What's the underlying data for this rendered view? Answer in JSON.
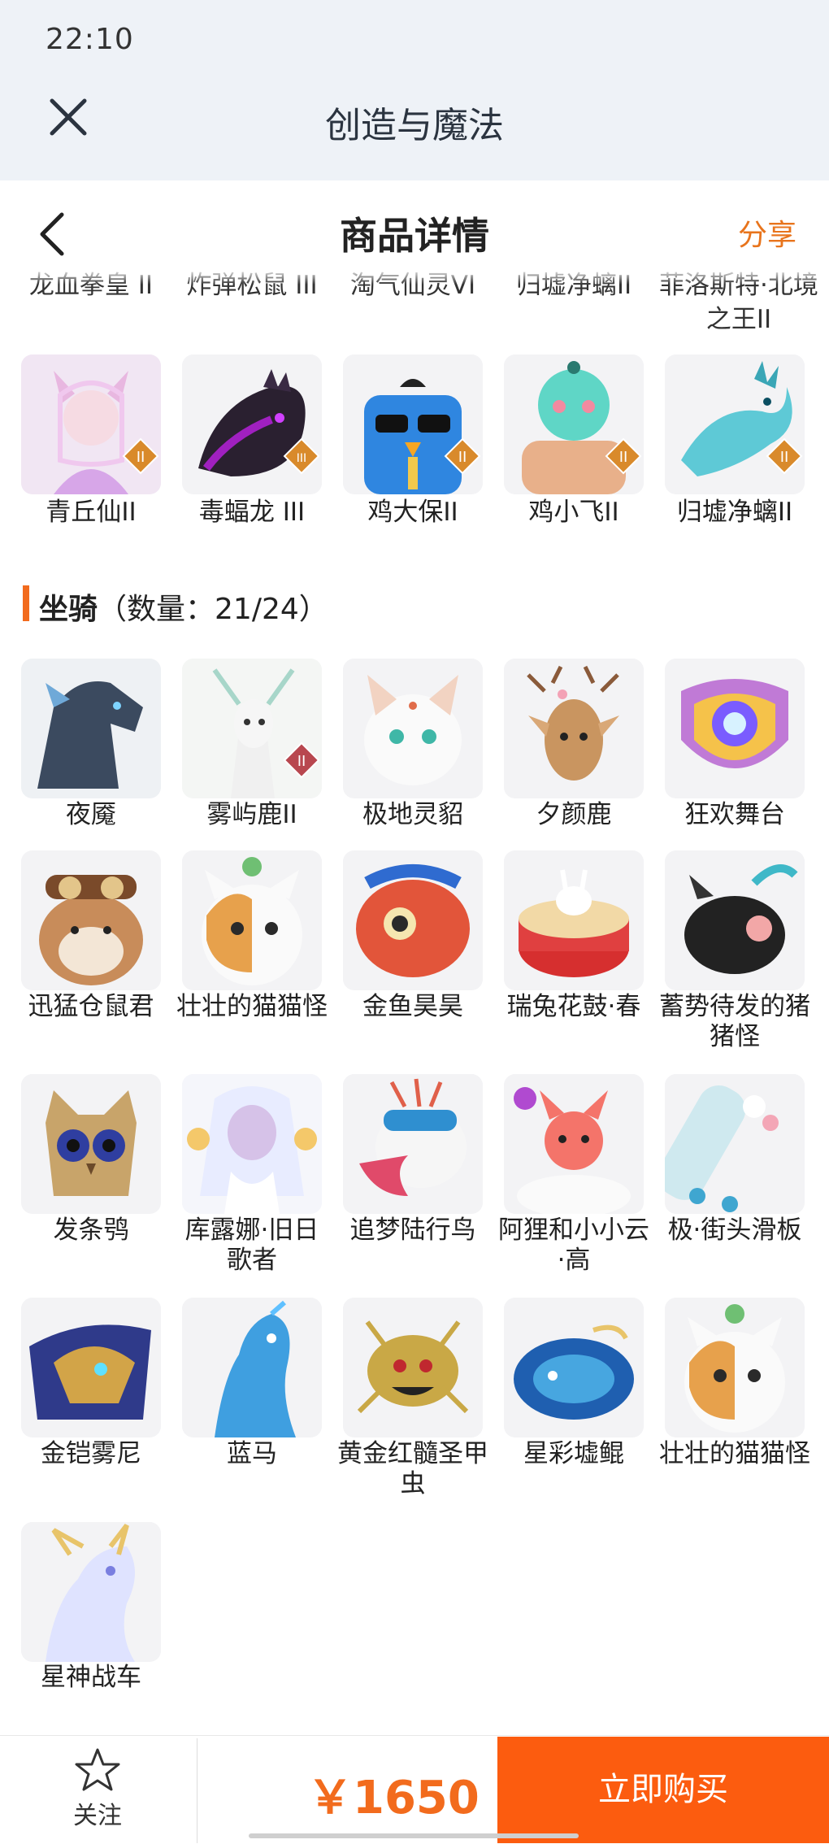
{
  "status": {
    "time": "22:10"
  },
  "app": {
    "title": "创造与魔法"
  },
  "nav": {
    "title": "商品详情",
    "share": "分享"
  },
  "partial_row": [
    "龙血拳皇 II",
    "炸弹松鼠 III",
    "淘气仙灵VI",
    "归墟净螭II",
    "菲洛斯特·北境之王II"
  ],
  "pets_row": [
    {
      "label": "青丘仙II",
      "badge": "II"
    },
    {
      "label": "毒蝠龙 III",
      "badge": "III"
    },
    {
      "label": "鸡大保II",
      "badge": "II"
    },
    {
      "label": "鸡小飞II",
      "badge": "II"
    },
    {
      "label": "归墟净螭II",
      "badge": "II"
    }
  ],
  "mounts_section": {
    "title": "坐骑",
    "count": "（数量：21/24）"
  },
  "mounts": [
    {
      "label": "夜魇"
    },
    {
      "label": "雾屿鹿II",
      "badge": "II"
    },
    {
      "label": "极地灵貂"
    },
    {
      "label": "夕颜鹿"
    },
    {
      "label": "狂欢舞台"
    },
    {
      "label": "迅猛仓鼠君"
    },
    {
      "label": "壮壮的猫猫怪"
    },
    {
      "label": "金鱼昊昊"
    },
    {
      "label": "瑞兔花鼓·春"
    },
    {
      "label": "蓄势待发的猪猪怪"
    },
    {
      "label": "发条鸮"
    },
    {
      "label": "库露娜·旧日歌者"
    },
    {
      "label": "追梦陆行鸟"
    },
    {
      "label": "阿狸和小小云·高"
    },
    {
      "label": "极·街头滑板"
    },
    {
      "label": "金铠雾尼"
    },
    {
      "label": "蓝马"
    },
    {
      "label": "黄金红髓圣甲虫"
    },
    {
      "label": "星彩墟鲲"
    },
    {
      "label": "壮壮的猫猫怪"
    },
    {
      "label": "星神战车"
    }
  ],
  "bottom": {
    "follow": "关注",
    "price": "￥1650",
    "buy": "立即购买"
  },
  "colors": {
    "accent": "#fc5c0f",
    "price": "#f26b1d",
    "badge": "#d98a2b"
  }
}
